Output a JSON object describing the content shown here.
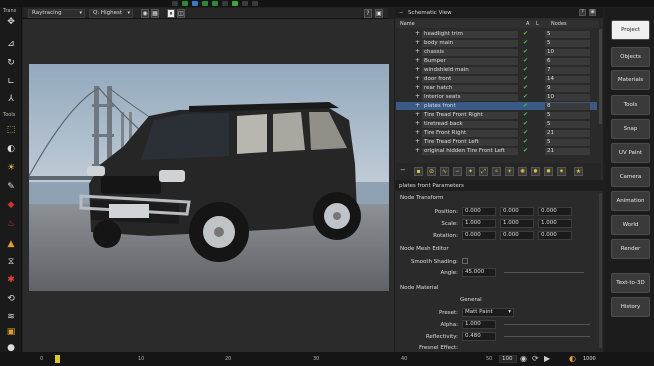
{
  "toolbar": {
    "render_mode": "Raytracing",
    "quality": "Q: Highest"
  },
  "left_tools": {
    "trans_label": "Trans",
    "tools_label": "Tools"
  },
  "schematic": {
    "title": "Schematic View",
    "col_name": "Name",
    "col_a": "A",
    "col_l": "L",
    "col_nodes": "Nodes",
    "rows": [
      {
        "name": "headlight trim",
        "nodes": "5"
      },
      {
        "name": "body main",
        "nodes": "5"
      },
      {
        "name": "chassis",
        "nodes": "10"
      },
      {
        "name": "Bumper",
        "nodes": "6"
      },
      {
        "name": "windshield main",
        "nodes": "7"
      },
      {
        "name": "door front",
        "nodes": "14"
      },
      {
        "name": "rear hatch",
        "nodes": "9"
      },
      {
        "name": "Interior seats",
        "nodes": "10"
      },
      {
        "name": "plates front",
        "nodes": "8",
        "selected": true
      },
      {
        "name": "Tire Tread Front Right",
        "nodes": "5"
      },
      {
        "name": "tiretread back",
        "nodes": "5"
      },
      {
        "name": "Tire Front Right",
        "nodes": "21"
      },
      {
        "name": "Tire Tread Front Left",
        "nodes": "5"
      },
      {
        "name": "original hidden Tire Front Left",
        "nodes": "21"
      }
    ],
    "check_mark": "✔",
    "plus": "+"
  },
  "params": {
    "title": "plates front Parameters",
    "node_transform": "Node Transform",
    "position_label": "Position:",
    "position": [
      "0.000",
      "0.000",
      "0.000"
    ],
    "scale_label": "Scale:",
    "scale": [
      "1.000",
      "1.000",
      "1.000"
    ],
    "rotation_label": "Rotation:",
    "rotation": [
      "0.000",
      "0.000",
      "0.000"
    ],
    "mesh_editor": "Node Mesh Editor",
    "smooth_label": "Smooth Shading:",
    "angle_label": "Angle:",
    "angle": "45.000",
    "node_material": "Node Material",
    "general": "General",
    "preset_label": "Preset:",
    "preset": "Matt Paint",
    "alpha_label": "Alpha:",
    "alpha": "1.000",
    "reflectivity_label": "Reflectivity:",
    "reflectivity": "0.480",
    "fresnel_label": "Fresnel Effect:"
  },
  "right_tabs": [
    "Project",
    "Objects",
    "Materials",
    "Tools",
    "Snap",
    "UV Paint",
    "Camera",
    "Animation",
    "World",
    "Render",
    "Text-to-3D",
    "History"
  ],
  "timeline": {
    "start": "0",
    "ticks": [
      "10",
      "20",
      "30",
      "40",
      "50"
    ],
    "end_frame": "100",
    "total": "1000"
  },
  "colors": {
    "accent_green": "#4cc24c",
    "selected_row": "#3a5a86",
    "active_tab": "#f0f0f0"
  }
}
